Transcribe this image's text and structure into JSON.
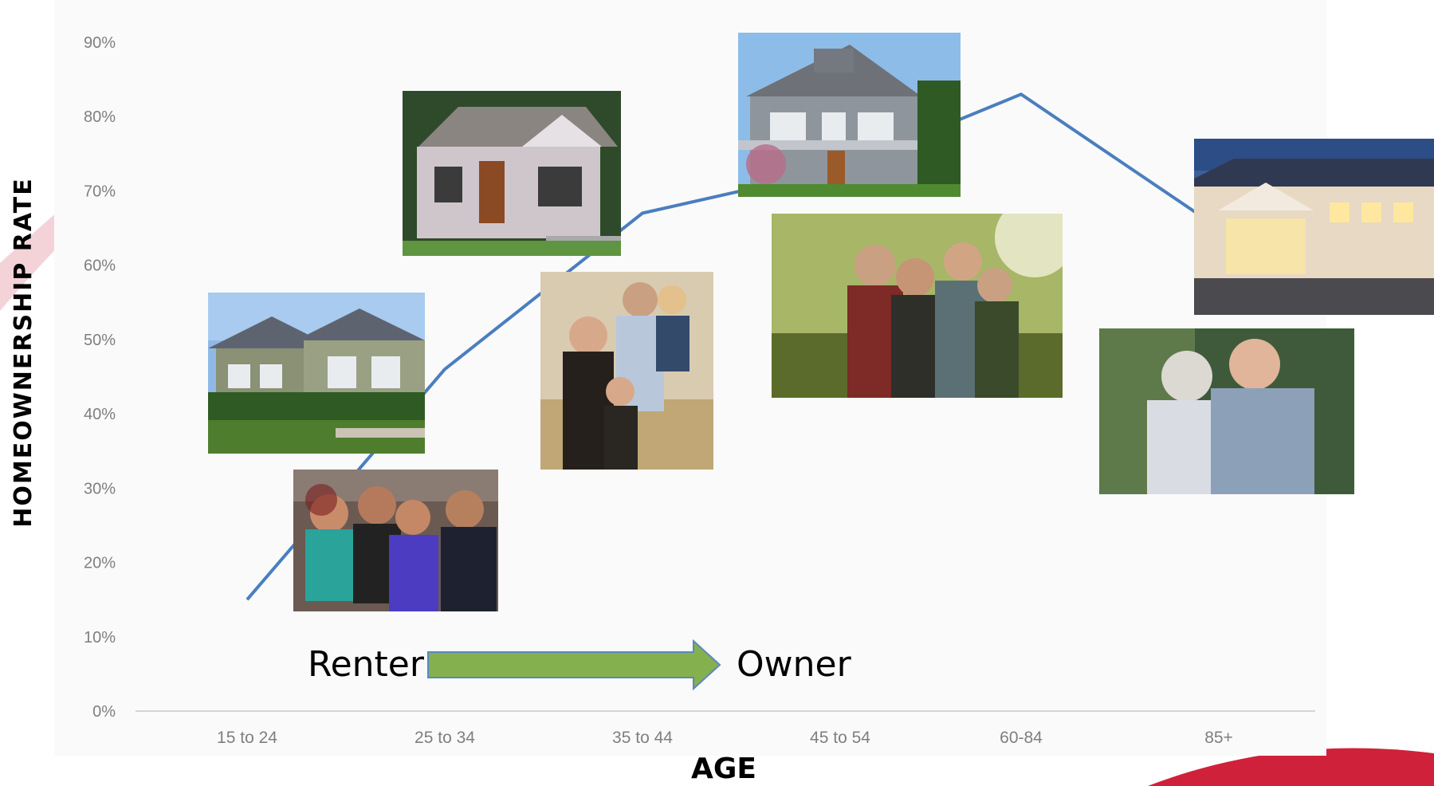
{
  "chart_data": {
    "type": "line",
    "ylabel": "HOMEOWNERSHIP RATE",
    "xlabel": "AGE",
    "categories": [
      "15 to 24",
      "25 to 34",
      "35 to 44",
      "45 to 54",
      "60-84",
      "85+"
    ],
    "ylim": [
      0,
      90
    ],
    "yticks": [
      "0%",
      "10%",
      "20%",
      "30%",
      "40%",
      "50%",
      "60%",
      "70%",
      "80%",
      "90%"
    ],
    "grid": false,
    "series": [
      {
        "values": [
          15,
          46,
          67,
          73,
          83,
          65
        ]
      }
    ],
    "colors": {
      "line": "#4a7ebf",
      "arrow": "#84b04e",
      "accent": "#d0213a"
    }
  },
  "annotations": {
    "renter": "Renter",
    "owner": "Owner"
  },
  "photos": [
    {
      "name": "townhouse-photo"
    },
    {
      "name": "young-adults-photo"
    },
    {
      "name": "bungalow-photo"
    },
    {
      "name": "young-family-photo"
    },
    {
      "name": "two-story-house-photo"
    },
    {
      "name": "family-of-four-photo"
    },
    {
      "name": "senior-living-photo"
    },
    {
      "name": "elderly-couple-photo"
    }
  ]
}
